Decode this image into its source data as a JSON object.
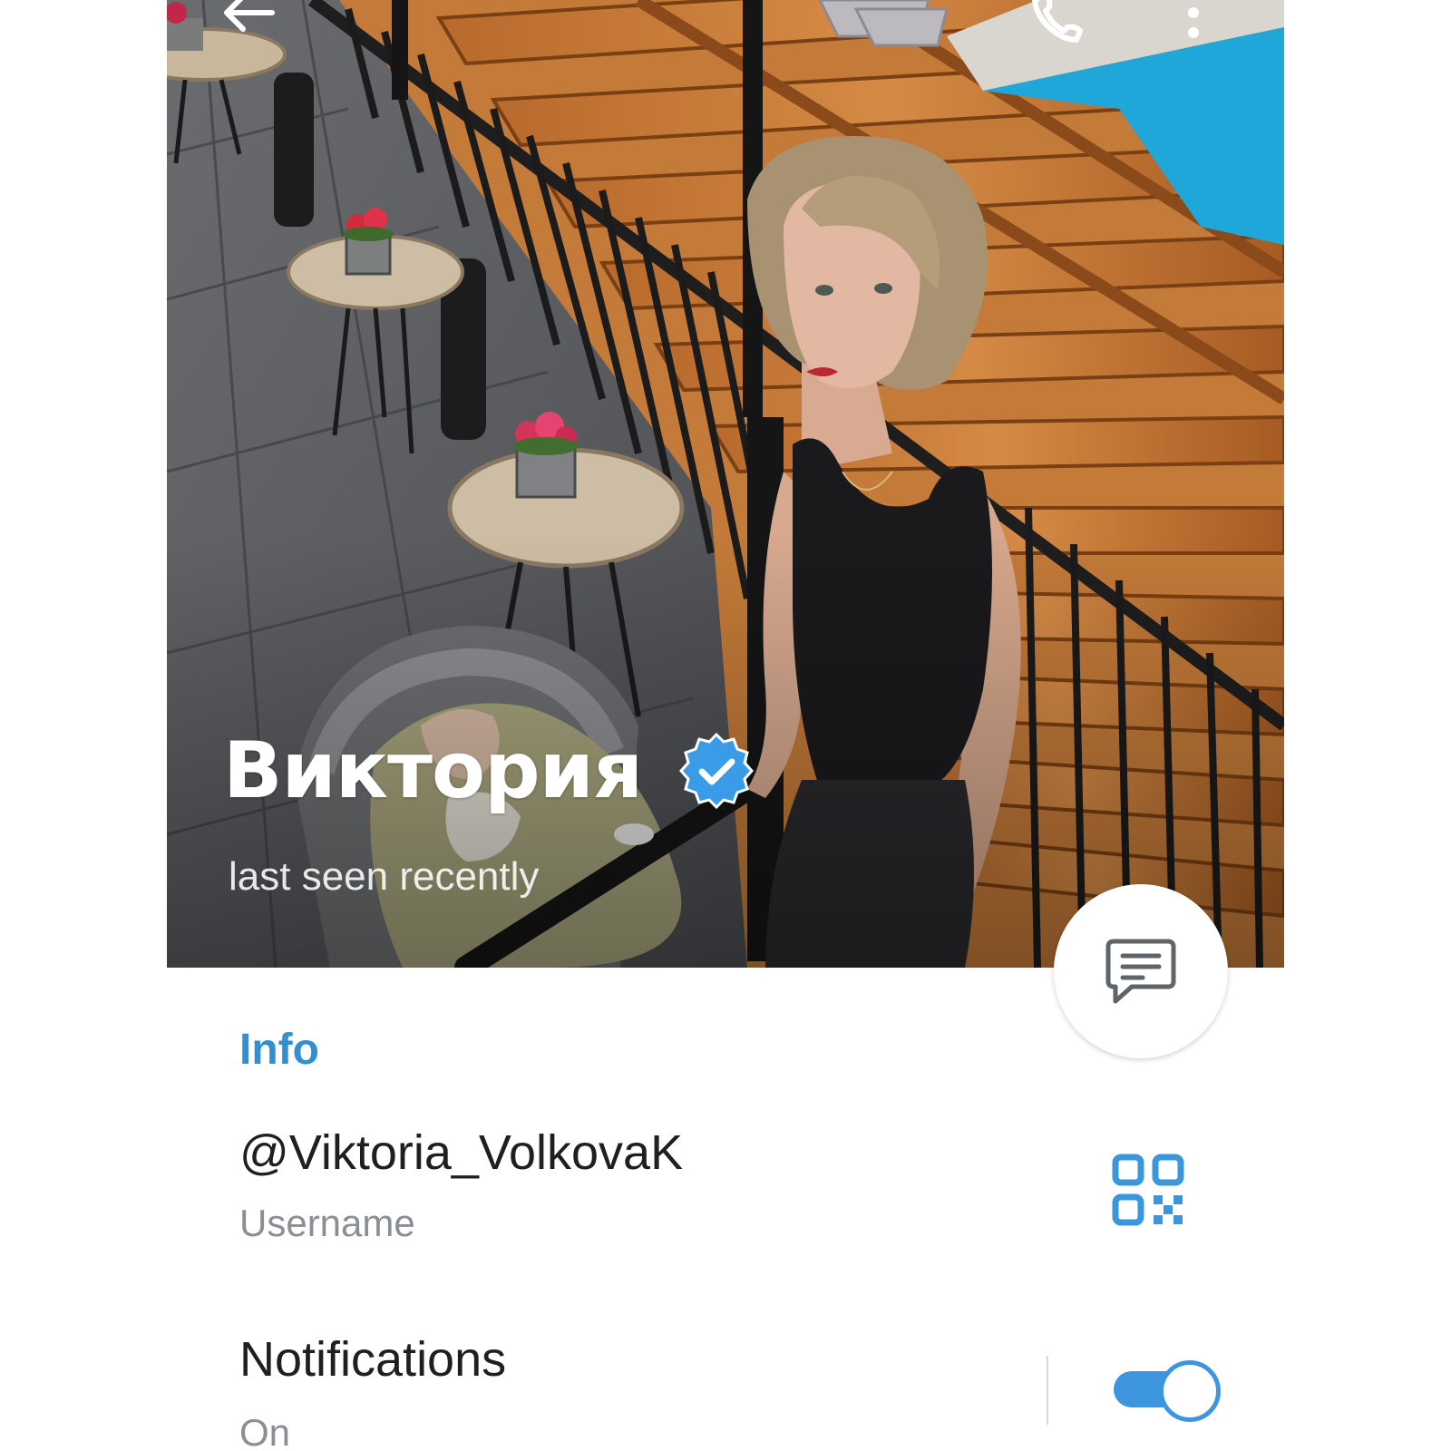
{
  "toolbar": {
    "back_icon": "arrow-left-icon",
    "call_icon": "phone-icon",
    "menu_icon": "more-vertical-icon"
  },
  "profile": {
    "name": "Виктория",
    "verified": true,
    "status": "last seen recently"
  },
  "fab": {
    "icon": "message-icon"
  },
  "info": {
    "title": "Info",
    "username": "@Viktoria_VolkovaK",
    "username_label": "Username",
    "qr_icon": "qr-code-icon",
    "notifications": "Notifications",
    "notifications_status": "On",
    "notifications_enabled": true
  },
  "colors": {
    "accent": "#3390d0",
    "toggle": "#3d95e0",
    "verified_badge": "#3a9be6"
  }
}
